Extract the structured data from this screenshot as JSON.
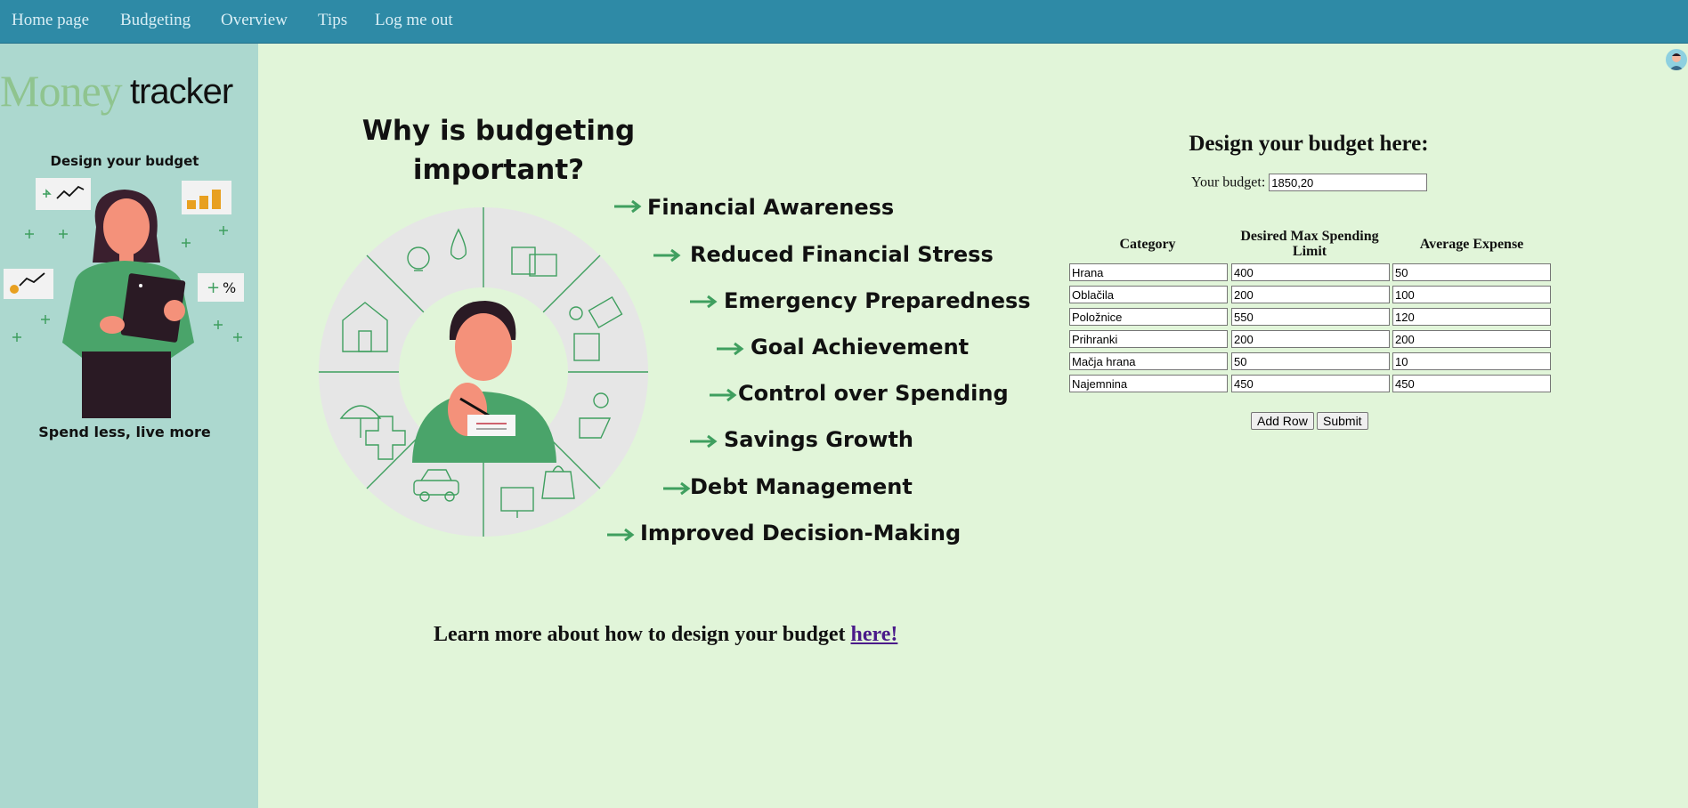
{
  "nav": {
    "items": [
      "Home page",
      "Budgeting",
      "Overview",
      "Tips",
      "Log me out"
    ]
  },
  "sidebar": {
    "logo_money": "Money",
    "logo_tracker": "tracker",
    "top_caption": "Design your budget",
    "bottom_caption": "Spend less, live more"
  },
  "infographic": {
    "title_line1": "Why is budgeting",
    "title_line2": "important?",
    "benefits": [
      "Financial Awareness",
      "Reduced Financial Stress",
      "Emergency Preparedness",
      "Goal Achievement",
      "Control over Spending",
      "Savings Growth",
      "Debt Management",
      "Improved Decision-Making"
    ]
  },
  "learn_more": {
    "text": "Learn more about how to design your budget ",
    "link": "here!"
  },
  "form": {
    "title": "Design your budget here:",
    "budget_label": "Your budget:",
    "budget_value": "1850,20",
    "headers": [
      "Category",
      "Desired Max Spending Limit",
      "Average Expense"
    ],
    "rows": [
      [
        "Hrana",
        "400",
        "50"
      ],
      [
        "Oblačila",
        "200",
        "100"
      ],
      [
        "Položnice",
        "550",
        "120"
      ],
      [
        "Prihranki",
        "200",
        "200"
      ],
      [
        "Mačja hrana",
        "50",
        "10"
      ],
      [
        "Najemnina",
        "450",
        "450"
      ]
    ],
    "add_row_label": "Add Row",
    "submit_label": "Submit"
  },
  "colors": {
    "nav_bg": "#2e8aa6",
    "sidebar_bg": "#acd8cf",
    "page_bg": "#e1f5d9",
    "accent_green": "#3f9f5f"
  }
}
